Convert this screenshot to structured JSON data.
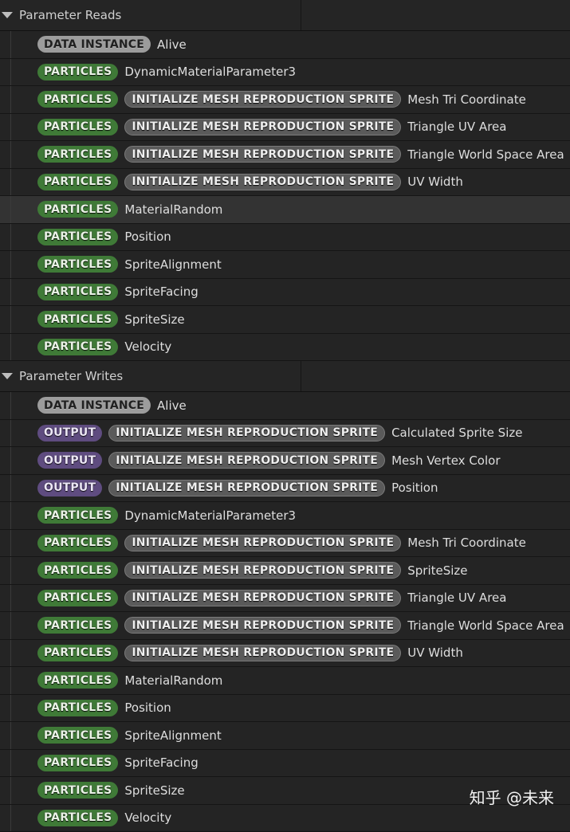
{
  "sections": [
    {
      "title": "Parameter Reads",
      "rows": [
        {
          "tags": [
            {
              "kind": "data-instance",
              "text": "DATA INSTANCE"
            }
          ],
          "label": "Alive"
        },
        {
          "tags": [
            {
              "kind": "particles",
              "text": "PARTICLES"
            }
          ],
          "label": "DynamicMaterialParameter3"
        },
        {
          "tags": [
            {
              "kind": "particles",
              "text": "PARTICLES"
            },
            {
              "kind": "module",
              "text": "INITIALIZE MESH REPRODUCTION SPRITE"
            }
          ],
          "label": "Mesh Tri Coordinate"
        },
        {
          "tags": [
            {
              "kind": "particles",
              "text": "PARTICLES"
            },
            {
              "kind": "module",
              "text": "INITIALIZE MESH REPRODUCTION SPRITE"
            }
          ],
          "label": "Triangle UV Area"
        },
        {
          "tags": [
            {
              "kind": "particles",
              "text": "PARTICLES"
            },
            {
              "kind": "module",
              "text": "INITIALIZE MESH REPRODUCTION SPRITE"
            }
          ],
          "label": "Triangle World Space Area"
        },
        {
          "tags": [
            {
              "kind": "particles",
              "text": "PARTICLES"
            },
            {
              "kind": "module",
              "text": "INITIALIZE MESH REPRODUCTION SPRITE"
            }
          ],
          "label": "UV Width"
        },
        {
          "tags": [
            {
              "kind": "particles",
              "text": "PARTICLES"
            }
          ],
          "label": "MaterialRandom",
          "selected": true
        },
        {
          "tags": [
            {
              "kind": "particles",
              "text": "PARTICLES"
            }
          ],
          "label": "Position"
        },
        {
          "tags": [
            {
              "kind": "particles",
              "text": "PARTICLES"
            }
          ],
          "label": "SpriteAlignment"
        },
        {
          "tags": [
            {
              "kind": "particles",
              "text": "PARTICLES"
            }
          ],
          "label": "SpriteFacing"
        },
        {
          "tags": [
            {
              "kind": "particles",
              "text": "PARTICLES"
            }
          ],
          "label": "SpriteSize"
        },
        {
          "tags": [
            {
              "kind": "particles",
              "text": "PARTICLES"
            }
          ],
          "label": "Velocity"
        }
      ]
    },
    {
      "title": "Parameter Writes",
      "rows": [
        {
          "tags": [
            {
              "kind": "data-instance",
              "text": "DATA INSTANCE"
            }
          ],
          "label": "Alive"
        },
        {
          "tags": [
            {
              "kind": "output",
              "text": "OUTPUT"
            },
            {
              "kind": "module",
              "text": "INITIALIZE MESH REPRODUCTION SPRITE"
            }
          ],
          "label": "Calculated Sprite Size"
        },
        {
          "tags": [
            {
              "kind": "output",
              "text": "OUTPUT"
            },
            {
              "kind": "module",
              "text": "INITIALIZE MESH REPRODUCTION SPRITE"
            }
          ],
          "label": "Mesh Vertex Color"
        },
        {
          "tags": [
            {
              "kind": "output",
              "text": "OUTPUT"
            },
            {
              "kind": "module",
              "text": "INITIALIZE MESH REPRODUCTION SPRITE"
            }
          ],
          "label": "Position"
        },
        {
          "tags": [
            {
              "kind": "particles",
              "text": "PARTICLES"
            }
          ],
          "label": "DynamicMaterialParameter3"
        },
        {
          "tags": [
            {
              "kind": "particles",
              "text": "PARTICLES"
            },
            {
              "kind": "module",
              "text": "INITIALIZE MESH REPRODUCTION SPRITE"
            }
          ],
          "label": "Mesh Tri Coordinate"
        },
        {
          "tags": [
            {
              "kind": "particles",
              "text": "PARTICLES"
            },
            {
              "kind": "module",
              "text": "INITIALIZE MESH REPRODUCTION SPRITE"
            }
          ],
          "label": "SpriteSize"
        },
        {
          "tags": [
            {
              "kind": "particles",
              "text": "PARTICLES"
            },
            {
              "kind": "module",
              "text": "INITIALIZE MESH REPRODUCTION SPRITE"
            }
          ],
          "label": "Triangle UV Area"
        },
        {
          "tags": [
            {
              "kind": "particles",
              "text": "PARTICLES"
            },
            {
              "kind": "module",
              "text": "INITIALIZE MESH REPRODUCTION SPRITE"
            }
          ],
          "label": "Triangle World Space Area"
        },
        {
          "tags": [
            {
              "kind": "particles",
              "text": "PARTICLES"
            },
            {
              "kind": "module",
              "text": "INITIALIZE MESH REPRODUCTION SPRITE"
            }
          ],
          "label": "UV Width"
        },
        {
          "tags": [
            {
              "kind": "particles",
              "text": "PARTICLES"
            }
          ],
          "label": "MaterialRandom"
        },
        {
          "tags": [
            {
              "kind": "particles",
              "text": "PARTICLES"
            }
          ],
          "label": "Position"
        },
        {
          "tags": [
            {
              "kind": "particles",
              "text": "PARTICLES"
            }
          ],
          "label": "SpriteAlignment"
        },
        {
          "tags": [
            {
              "kind": "particles",
              "text": "PARTICLES"
            }
          ],
          "label": "SpriteFacing"
        },
        {
          "tags": [
            {
              "kind": "particles",
              "text": "PARTICLES"
            }
          ],
          "label": "SpriteSize"
        },
        {
          "tags": [
            {
              "kind": "particles",
              "text": "PARTICLES"
            }
          ],
          "label": "Velocity"
        }
      ]
    }
  ],
  "watermark": "知乎 @未来",
  "colors": {
    "particles": "#3f7a37",
    "data_instance": "#9c9c9c",
    "output": "#5f4c80",
    "module": "#5a5a5a",
    "selected_row": "#333333"
  }
}
